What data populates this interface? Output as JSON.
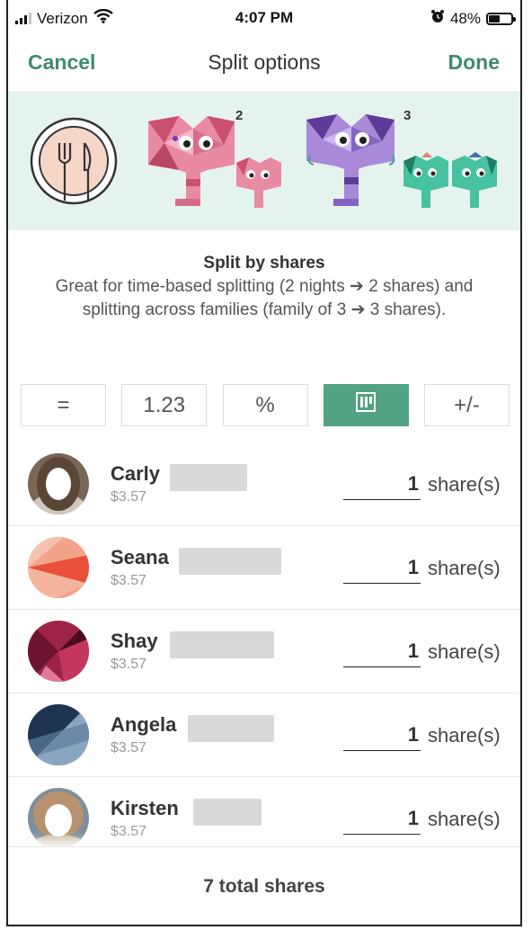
{
  "status_bar": {
    "carrier": "Verizon",
    "time": "4:07 PM",
    "battery": "48%",
    "battery_level": 0.48,
    "icons": [
      "signal-icon",
      "wifi-icon",
      "alarm-icon",
      "battery-icon"
    ]
  },
  "nav": {
    "cancel_label": "Cancel",
    "title": "Split options",
    "done_label": "Done"
  },
  "banner": {
    "icons": [
      "plate-cutlery-icon",
      "pink-elephant-pair-icon",
      "purple-elephant-family-icon"
    ],
    "group1_count": "2",
    "group2_count": "3"
  },
  "description": {
    "title": "Split by shares",
    "body": "Great for time-based splitting (2 nights ➔ 2 shares) and splitting across families (family of 3 ➔ 3 shares)."
  },
  "tabs": [
    {
      "label": "=",
      "icon": "equal-icon",
      "active": false
    },
    {
      "label": "1.23",
      "icon": "exact-amount-icon",
      "active": false
    },
    {
      "label": "%",
      "icon": "percent-icon",
      "active": false
    },
    {
      "label": "",
      "icon": "shares-bars-icon",
      "active": true
    },
    {
      "label": "+/-",
      "icon": "adjustment-icon",
      "active": false
    }
  ],
  "members": [
    {
      "name": "Carly",
      "amount": "$3.57",
      "shares": "1",
      "unit": "share(s)"
    },
    {
      "name": "Seana",
      "amount": "$3.57",
      "shares": "1",
      "unit": "share(s)"
    },
    {
      "name": "Shay",
      "amount": "$3.57",
      "shares": "1",
      "unit": "share(s)"
    },
    {
      "name": "Angela",
      "amount": "$3.57",
      "shares": "1",
      "unit": "share(s)"
    },
    {
      "name": "Kirsten",
      "amount": "$3.57",
      "shares": "1",
      "unit": "share(s)"
    }
  ],
  "footer": {
    "total_label": "7 total shares"
  },
  "colors": {
    "accent": "#52a383",
    "nav_text": "#3f8a72",
    "banner_bg": "#e5f3ef"
  }
}
